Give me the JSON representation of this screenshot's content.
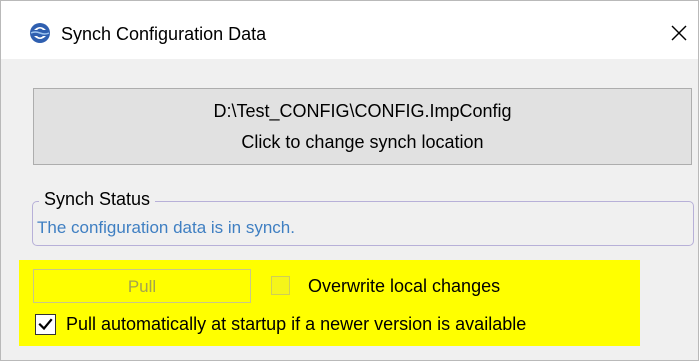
{
  "window": {
    "title": "Synch Configuration Data",
    "app_icon": "synch-globe-icon",
    "close_icon": "close-icon"
  },
  "location_button": {
    "path": "D:\\Test_CONFIG\\CONFIG.ImpConfig",
    "hint": "Click to change synch location"
  },
  "synch_status": {
    "legend": "Synch Status",
    "message": "The configuration data is in synch.",
    "message_color": "#3f7fc2"
  },
  "actions": {
    "pull_label": "Pull",
    "pull_enabled": false,
    "overwrite_label": "Overwrite local changes",
    "overwrite_checked": false,
    "overwrite_enabled": false,
    "auto_pull_label": "Pull automatically at startup if a newer version is available",
    "auto_pull_checked": true
  },
  "colors": {
    "highlight": "#ffff00",
    "window_bg": "#f0f0f0"
  }
}
